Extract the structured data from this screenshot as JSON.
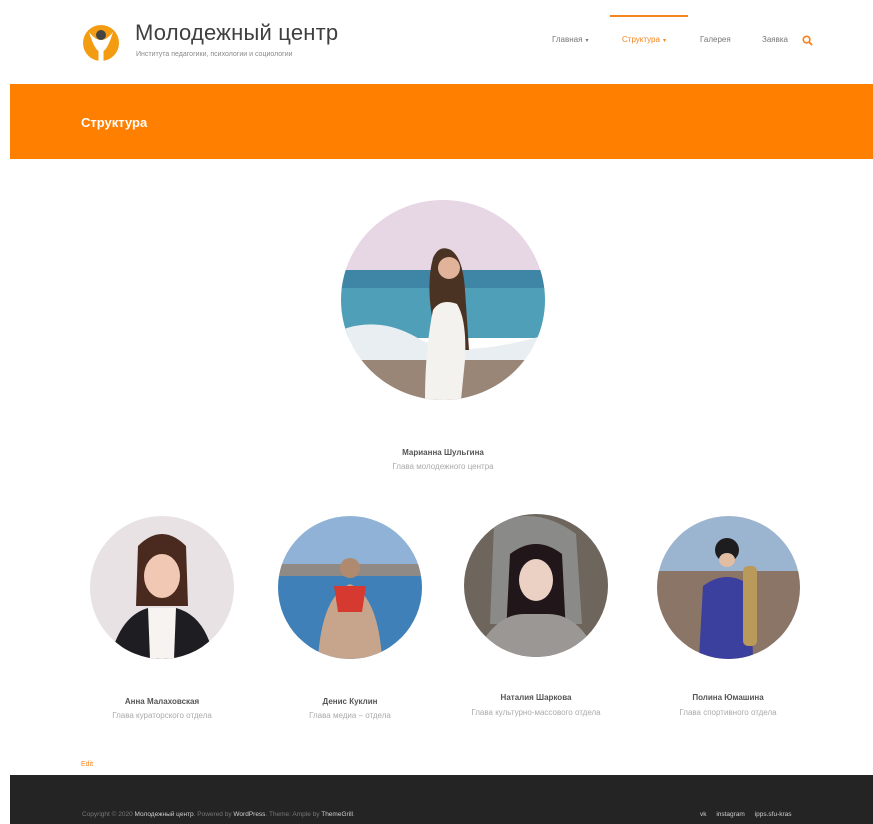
{
  "header": {
    "site_title": "Молодежный центр",
    "site_description": "Института педагогики, психологии и социологии",
    "nav": [
      {
        "label": "Главная",
        "caret": "▾"
      },
      {
        "label": "Структура",
        "caret": "▾"
      },
      {
        "label": "Галерея"
      },
      {
        "label": "Заявка"
      }
    ],
    "search_icon": "search-icon"
  },
  "banner": {
    "title": "Структура"
  },
  "team": {
    "head": {
      "name": "Марианна Шульгина",
      "role": "Глава молодежного центра"
    },
    "members": [
      {
        "name": "Анна Малаховская",
        "role": "Глава кураторского отдела"
      },
      {
        "name": "Денис Куклин",
        "role": "Глава медиа – отдела"
      },
      {
        "name": "Наталия Шаркова",
        "role": "Глава культурно-массового отдела"
      },
      {
        "name": "Полина Юмашина",
        "role": "Глава спортивного отдела"
      }
    ]
  },
  "edit_label": "Edit",
  "footer": {
    "copyright_prefix": "Copyright © 2020",
    "site_link": "Молодежный центр",
    "powered_by": "Powered by",
    "wordpress": "WordPress",
    "theme_text": "Theme: Ample by",
    "themegrill": "ThemeGrill",
    "links": [
      "vk",
      "instagram",
      "ipps.sfu-kras"
    ]
  },
  "colors": {
    "accent": "#ff7f00",
    "footer_bg": "#242424"
  }
}
